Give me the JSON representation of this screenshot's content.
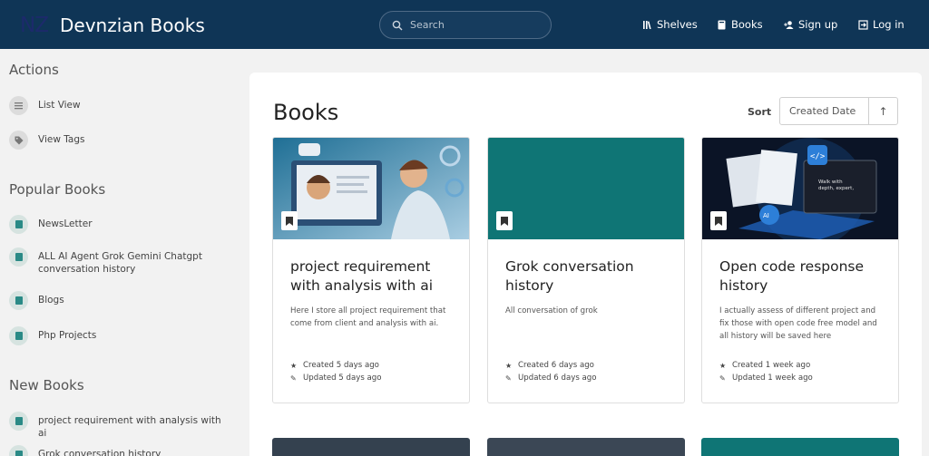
{
  "header": {
    "logo_text": "NZ",
    "title": "Devnzian Books",
    "search_placeholder": "Search",
    "nav": {
      "shelves": "Shelves",
      "books": "Books",
      "signup": "Sign up",
      "login": "Log in"
    }
  },
  "sidebar": {
    "actions_title": "Actions",
    "actions": [
      "List View",
      "View Tags"
    ],
    "popular_title": "Popular Books",
    "popular": [
      "NewsLetter",
      "ALL AI Agent Grok Gemini Chatgpt conversation history",
      "Blogs",
      "Php Projects"
    ],
    "new_title": "New Books",
    "new": [
      "project requirement with analysis with ai",
      "Grok conversation history"
    ]
  },
  "main": {
    "title": "Books",
    "sort_label": "Sort",
    "sort_value": "Created Date",
    "sort_direction": "↑",
    "cards": [
      {
        "title": "project requirement with analysis with ai",
        "description": "Here I store all project requirement that come from client and analysis with ai.",
        "created": "Created 5 days ago",
        "updated": "Updated 5 days ago"
      },
      {
        "title": "Grok conversation history",
        "description": "All conversation of grok",
        "created": "Created 6 days ago",
        "updated": "Updated 6 days ago"
      },
      {
        "title": "Open code response history",
        "description": "I actually assess of different project and fix those with open code free model and all history will be saved here",
        "created": "Created 1 week ago",
        "updated": "Updated 1 week ago"
      }
    ]
  },
  "colors": {
    "header_bg": "#0f3556",
    "teal": "#0f7575",
    "page_bg": "#f2f2f2"
  },
  "icons": [
    "search-icon",
    "shelves-icon",
    "books-icon",
    "user-plus-icon",
    "login-icon",
    "list-icon",
    "tag-icon",
    "book-icon",
    "star-icon",
    "pencil-icon"
  ]
}
